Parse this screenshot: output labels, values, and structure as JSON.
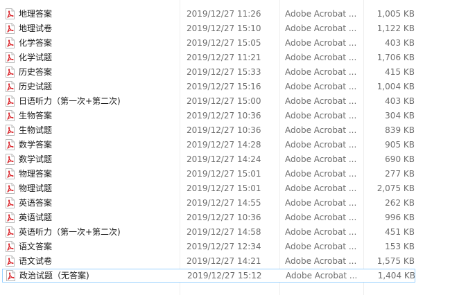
{
  "icon": "pdf-file-icon",
  "colors": {
    "name_text": "#1a1a1a",
    "meta_text": "#6d6d6d",
    "selection_border": "#99d1ff",
    "pdf_red": "#d9262c"
  },
  "files": [
    {
      "name": "地理答案",
      "date": "2019/12/27 11:26",
      "type": "Adobe Acrobat ...",
      "size": "1,005 KB"
    },
    {
      "name": "地理试卷",
      "date": "2019/12/27 15:10",
      "type": "Adobe Acrobat ...",
      "size": "1,122 KB"
    },
    {
      "name": "化学答案",
      "date": "2019/12/27 15:05",
      "type": "Adobe Acrobat ...",
      "size": "403 KB"
    },
    {
      "name": "化学试题",
      "date": "2019/12/27 11:21",
      "type": "Adobe Acrobat ...",
      "size": "1,706 KB"
    },
    {
      "name": "历史答案",
      "date": "2019/12/27 15:33",
      "type": "Adobe Acrobat ...",
      "size": "415 KB"
    },
    {
      "name": "历史试题",
      "date": "2019/12/27 15:16",
      "type": "Adobe Acrobat ...",
      "size": "1,004 KB"
    },
    {
      "name": "日语听力（第一次+第二次)",
      "date": "2019/12/27 15:00",
      "type": "Adobe Acrobat ...",
      "size": "403 KB"
    },
    {
      "name": "生物答案",
      "date": "2019/12/27 10:36",
      "type": "Adobe Acrobat ...",
      "size": "304 KB"
    },
    {
      "name": "生物试题",
      "date": "2019/12/27 10:36",
      "type": "Adobe Acrobat ...",
      "size": "839 KB"
    },
    {
      "name": "数学答案",
      "date": "2019/12/27 14:28",
      "type": "Adobe Acrobat ...",
      "size": "905 KB"
    },
    {
      "name": "数学试题",
      "date": "2019/12/27 14:24",
      "type": "Adobe Acrobat ...",
      "size": "690 KB"
    },
    {
      "name": "物理答案",
      "date": "2019/12/27 15:01",
      "type": "Adobe Acrobat ...",
      "size": "277 KB"
    },
    {
      "name": "物理试题",
      "date": "2019/12/27 15:01",
      "type": "Adobe Acrobat ...",
      "size": "2,075 KB"
    },
    {
      "name": "英语答案",
      "date": "2019/12/27 14:55",
      "type": "Adobe Acrobat ...",
      "size": "262 KB"
    },
    {
      "name": "英语试题",
      "date": "2019/12/27 10:36",
      "type": "Adobe Acrobat ...",
      "size": "996 KB"
    },
    {
      "name": "英语听力（第一次+第二次)",
      "date": "2019/12/27 14:58",
      "type": "Adobe Acrobat ...",
      "size": "451 KB"
    },
    {
      "name": "语文答案",
      "date": "2019/12/27 12:34",
      "type": "Adobe Acrobat ...",
      "size": "153 KB"
    },
    {
      "name": "语文试卷",
      "date": "2019/12/27 14:21",
      "type": "Adobe Acrobat ...",
      "size": "1,575 KB"
    },
    {
      "name": "政治试题（无答案)",
      "date": "2019/12/27 15:12",
      "type": "Adobe Acrobat ...",
      "size": "1,404 KB",
      "selected": true
    }
  ]
}
